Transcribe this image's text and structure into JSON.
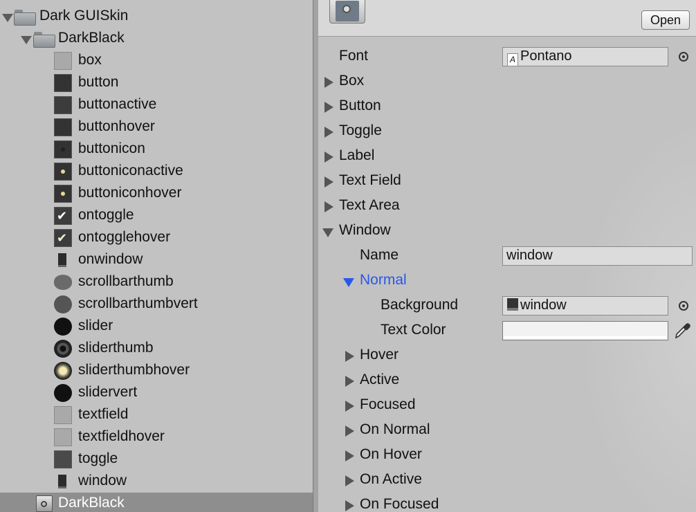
{
  "tree": {
    "root_label": "Dark GUISkin",
    "folder_label": "DarkBlack",
    "items": [
      {
        "label": "box"
      },
      {
        "label": "button"
      },
      {
        "label": "buttonactive"
      },
      {
        "label": "buttonhover"
      },
      {
        "label": "buttonicon"
      },
      {
        "label": "buttoniconactive"
      },
      {
        "label": "buttoniconhover"
      },
      {
        "label": "ontoggle"
      },
      {
        "label": "ontogglehover"
      },
      {
        "label": "onwindow"
      },
      {
        "label": "scrollbarthumb"
      },
      {
        "label": "scrollbarthumbvert"
      },
      {
        "label": "slider"
      },
      {
        "label": "sliderthumb"
      },
      {
        "label": "sliderthumbhover"
      },
      {
        "label": "slidervert"
      },
      {
        "label": "textfield"
      },
      {
        "label": "textfieldhover"
      },
      {
        "label": "toggle"
      },
      {
        "label": "window"
      }
    ],
    "selected_label": "DarkBlack"
  },
  "inspector": {
    "open_label": "Open",
    "font_label": "Font",
    "font_value": "Pontano",
    "sections": [
      "Box",
      "Button",
      "Toggle",
      "Label",
      "Text Field",
      "Text Area"
    ],
    "window_label": "Window",
    "name_label": "Name",
    "name_value": "window",
    "normal_label": "Normal",
    "background_label": "Background",
    "background_value": "window",
    "text_color_label": "Text Color",
    "text_color_value": "#f2f2f2",
    "states": [
      "Hover",
      "Active",
      "Focused",
      "On Normal",
      "On Hover",
      "On Active",
      "On Focused"
    ]
  }
}
